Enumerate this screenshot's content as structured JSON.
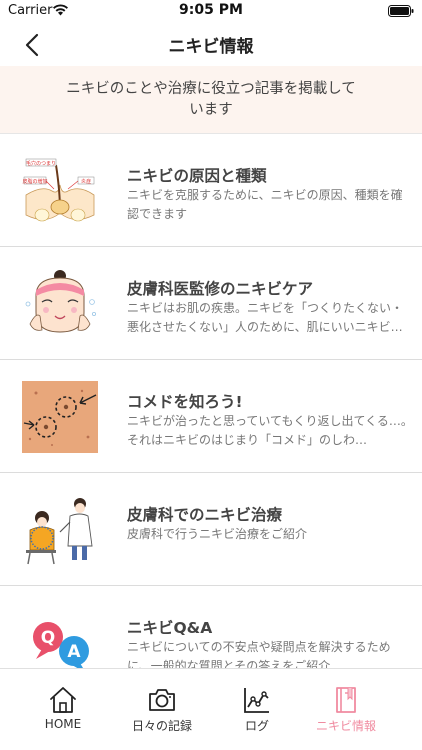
{
  "status_bar": {
    "carrier": "Carrier",
    "time": "9:05 PM"
  },
  "nav": {
    "title": "ニキビ情報",
    "back_icon": "chevron-left-icon"
  },
  "banner": {
    "text": "ニキビのことや治療に役立つ記事を掲載しています"
  },
  "articles": [
    {
      "title": "ニキビの原因と種類",
      "description": "ニキビを克服するために、ニキビの原因、種類を確認できます",
      "thumb_icon": "skin-pore-diagram-icon",
      "thumb_labels": [
        "毛穴のつまり",
        "皮脂の増加",
        "炎症"
      ]
    },
    {
      "title": "皮膚科医監修のニキビケア",
      "description": "ニキビはお肌の疾患。ニキビを「つくりたくない・悪化させたくない」人のために、肌にいいニキビ…",
      "thumb_icon": "face-washing-woman-icon"
    },
    {
      "title": "コメドを知ろう!",
      "description": "ニキビが治ったと思っていてもくり返し出てくる…。それはニキビのはじまり「コメド」のしわ…",
      "thumb_icon": "comedo-skin-closeup-icon"
    },
    {
      "title": "皮膚科でのニキビ治療",
      "description": "皮膚科で行うニキビ治療をご紹介",
      "thumb_icon": "doctor-patient-icon"
    },
    {
      "title": "ニキビQ&A",
      "description": "ニキビについての不安点や疑問点を解決するために、一般的な質問とその答えをご紹介",
      "thumb_icon": "qa-bubbles-icon",
      "thumb_labels": [
        "Q",
        "A"
      ]
    }
  ],
  "tabs": [
    {
      "label": "HOME",
      "icon": "home-icon",
      "active": false
    },
    {
      "label": "日々の記録",
      "icon": "camera-icon",
      "active": false
    },
    {
      "label": "ログ",
      "icon": "chart-icon",
      "active": false
    },
    {
      "label": "ニキビ情報",
      "icon": "book-icon",
      "active": true
    }
  ],
  "colors": {
    "accent": "#f08ba0",
    "banner_bg": "#fdf4ef",
    "q_bubble": "#e8506a",
    "a_bubble": "#2f9be0"
  }
}
